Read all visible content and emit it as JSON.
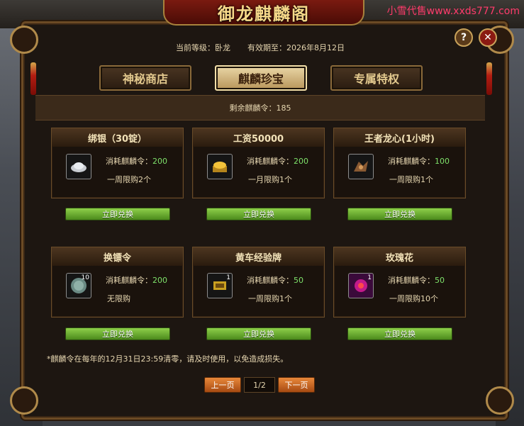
{
  "watermark": "小雪代售www.xxds777.com",
  "title": "御龙麒麟阁",
  "info": {
    "level": "当前等级：卧龙",
    "expiry": "有效期至：2026年8月12日"
  },
  "tabs": [
    {
      "label": "神秘商店",
      "active": false
    },
    {
      "label": "麒麟珍宝",
      "active": true
    },
    {
      "label": "专属特权",
      "active": false
    }
  ],
  "remaining": "剩余麒麟令：185",
  "items": [
    {
      "name": "绑银（30锭）",
      "cost_label": "消耗麒麟令：",
      "cost": "200",
      "limit": "一周限购2个",
      "icon": "silver-ingot-icon",
      "qty": ""
    },
    {
      "name": "工资50000",
      "cost_label": "消耗麒麟令：",
      "cost": "200",
      "limit": "一月限购1个",
      "icon": "gold-ingot-icon",
      "qty": ""
    },
    {
      "name": "王者龙心(1小时)",
      "cost_label": "消耗麒麟令：",
      "cost": "100",
      "limit": "一周限购1个",
      "icon": "dragon-heart-icon",
      "qty": ""
    },
    {
      "name": "换镖令",
      "cost_label": "消耗麒麟令：",
      "cost": "200",
      "limit": "无限购",
      "icon": "escort-token-icon",
      "qty": "10"
    },
    {
      "name": "黄车经验牌",
      "cost_label": "消耗麒麟令：",
      "cost": "50",
      "limit": "一周限购1个",
      "icon": "cart-exp-icon",
      "qty": "1"
    },
    {
      "name": "玫瑰花",
      "cost_label": "消耗麒麟令：",
      "cost": "50",
      "limit": "一周限购10个",
      "icon": "rose-icon",
      "qty": "1"
    }
  ],
  "redeem_label": "立即兑换",
  "note": "*麒麟令在每年的12月31日23:59清零，请及时使用，以免造成损失。",
  "pager": {
    "prev": "上一页",
    "page": "1/2",
    "next": "下一页"
  },
  "controls": {
    "help": "?",
    "close": "✕"
  }
}
